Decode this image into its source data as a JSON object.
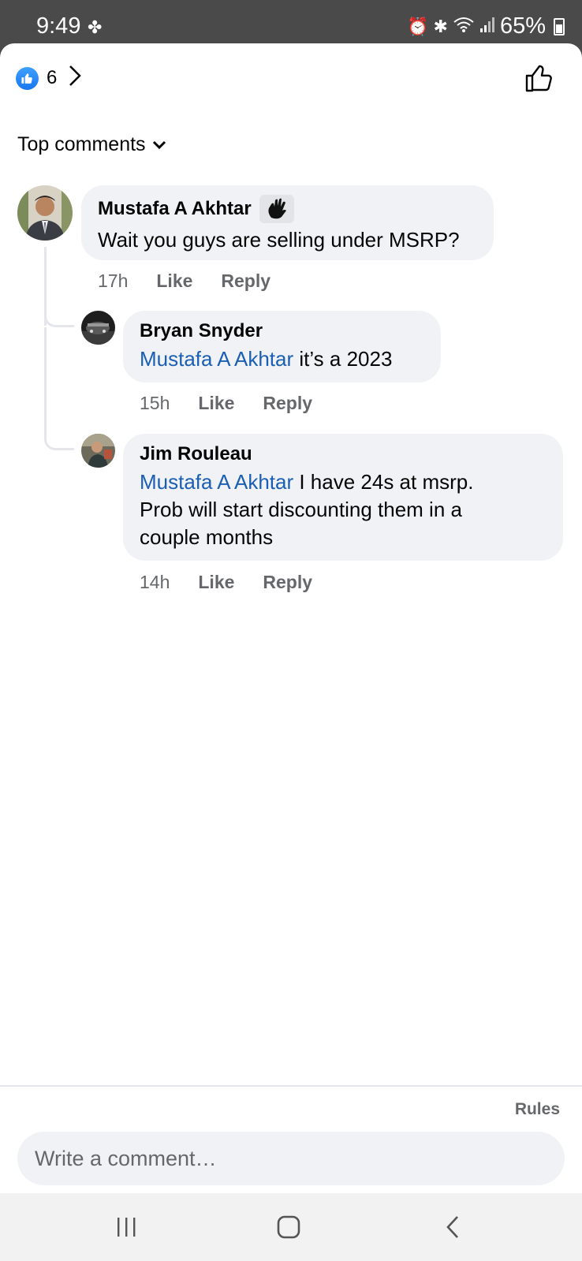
{
  "status_bar": {
    "time": "9:49",
    "battery": "65%"
  },
  "reactions": {
    "count": "6"
  },
  "sort": {
    "label": "Top comments"
  },
  "comments": [
    {
      "author": "Mustafa A Akhtar",
      "mention": "",
      "text": "Wait you guys are selling under MSRP?",
      "time": "17h",
      "like": "Like",
      "reply": "Reply"
    },
    {
      "author": "Bryan Snyder",
      "mention": "Mustafa A Akhtar",
      "text": " it’s a 2023",
      "time": "15h",
      "like": "Like",
      "reply": "Reply"
    },
    {
      "author": "Jim Rouleau",
      "mention": "Mustafa A Akhtar",
      "text_line1": " I have 24s at msrp.",
      "text_line2": "Prob will start discounting them in a",
      "text_line3": "couple months",
      "time": "14h",
      "like": "Like",
      "reply": "Reply"
    }
  ],
  "footer": {
    "rules": "Rules",
    "placeholder": "Write a comment…"
  },
  "colors": {
    "accent": "#1877f2",
    "mention": "#1b5fb4",
    "bubble": "#f0f2f5"
  }
}
